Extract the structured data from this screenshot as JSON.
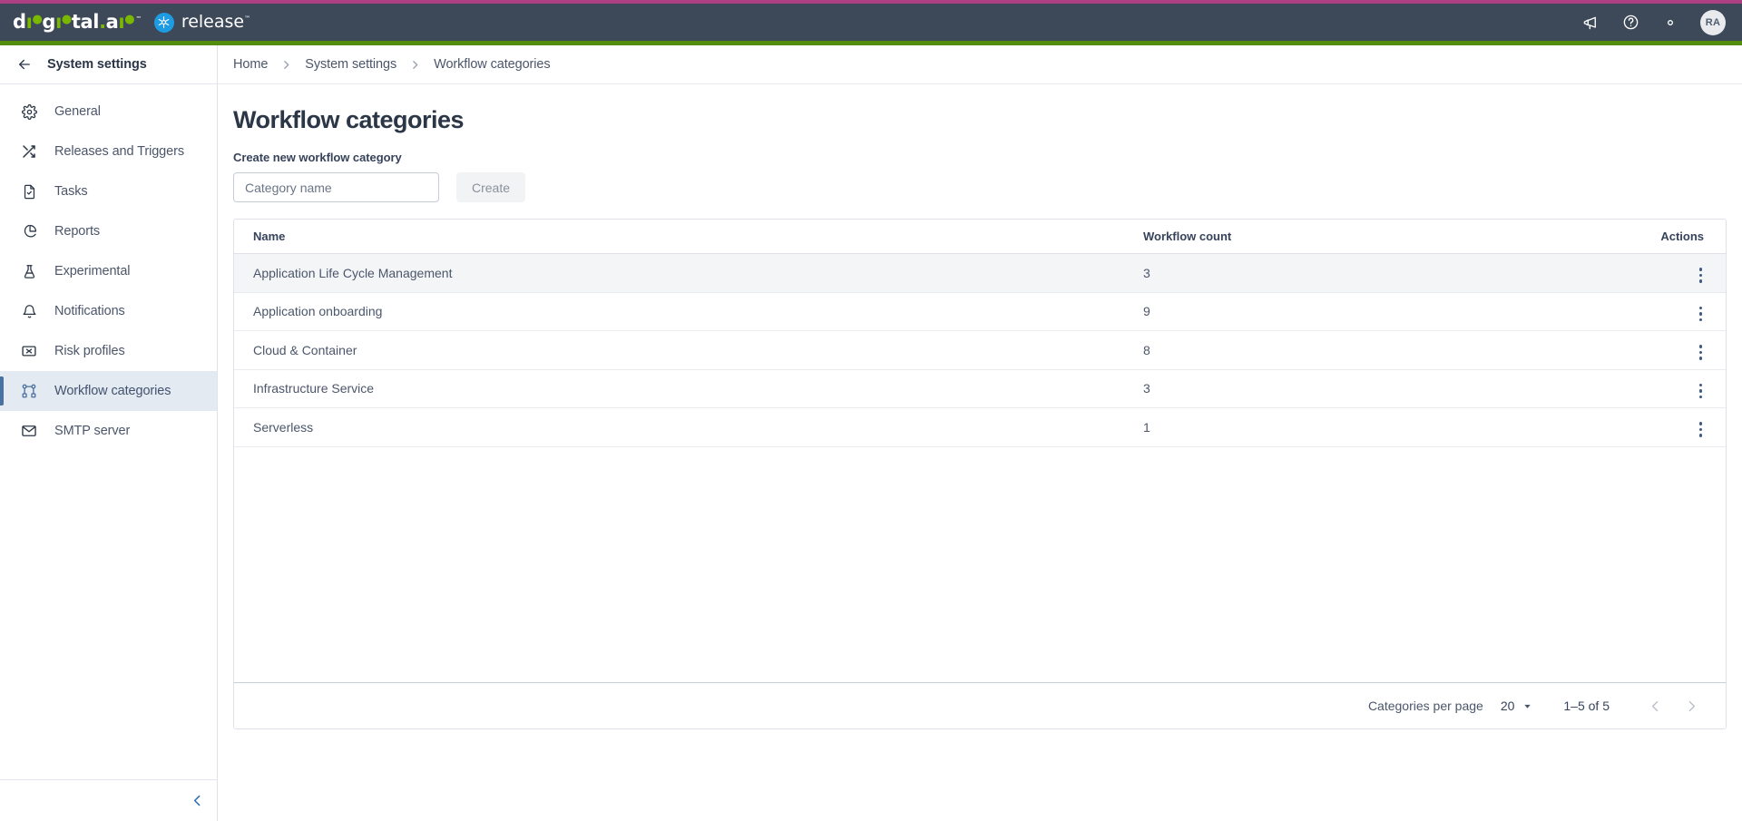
{
  "colors": {
    "top_accent": "#ad3f83",
    "topbar_bg": "#3d4859",
    "green_rule": "#548c0e",
    "brand_blue": "#1e9ce3",
    "logo_green": "#7ab800",
    "sidebar_selected_bg": "#e4eaf2",
    "sidebar_selected_accent": "#4a72a0",
    "row_hover": "#f4f5f7",
    "text_primary": "#2b3647",
    "text_secondary": "#4b566b",
    "border": "#dfe3e9"
  },
  "topbar": {
    "logo_primary": "digital.ai",
    "logo_primary_tm": "™",
    "logo_product": "release",
    "logo_product_tm": "™",
    "product_badge_icon": "release-cycle-icon",
    "actions": [
      {
        "name": "announcements-icon",
        "label": "Announcements"
      },
      {
        "name": "help-icon",
        "label": "Help"
      },
      {
        "name": "gear-icon",
        "label": "Settings"
      }
    ],
    "avatar_initials": "RA"
  },
  "sidebar": {
    "back_icon": "arrow-left-icon",
    "title": "System settings",
    "collapse_icon": "chevron-left-icon",
    "items": [
      {
        "label": "General",
        "icon": "gear-icon",
        "selected": false
      },
      {
        "label": "Releases and Triggers",
        "icon": "shuffle-icon",
        "selected": false
      },
      {
        "label": "Tasks",
        "icon": "document-check-icon",
        "selected": false
      },
      {
        "label": "Reports",
        "icon": "pie-chart-icon",
        "selected": false
      },
      {
        "label": "Experimental",
        "icon": "flask-icon",
        "selected": false
      },
      {
        "label": "Notifications",
        "icon": "bell-icon",
        "selected": false
      },
      {
        "label": "Risk profiles",
        "icon": "risk-shield-icon",
        "selected": false
      },
      {
        "label": "Workflow categories",
        "icon": "workflow-nodes-icon",
        "selected": true
      },
      {
        "label": "SMTP server",
        "icon": "envelope-icon",
        "selected": false
      }
    ]
  },
  "breadcrumb": {
    "separator_icon": "chevron-right-icon",
    "items": [
      {
        "label": "Home"
      },
      {
        "label": "System settings"
      },
      {
        "label": "Workflow categories"
      }
    ]
  },
  "page": {
    "title": "Workflow categories",
    "create_section_label": "Create new workflow category",
    "input_placeholder": "Category name",
    "input_value": "",
    "create_button_label": "Create",
    "create_button_disabled": true
  },
  "table": {
    "columns": {
      "name": "Name",
      "count": "Workflow count",
      "actions": "Actions"
    },
    "row_action_icon": "kebab-menu-icon",
    "rows": [
      {
        "name": "Application Life Cycle Management",
        "count": "3",
        "hovered": true
      },
      {
        "name": "Application onboarding",
        "count": "9",
        "hovered": false
      },
      {
        "name": "Cloud & Container",
        "count": "8",
        "hovered": false
      },
      {
        "name": "Infrastructure Service",
        "count": "3",
        "hovered": false
      },
      {
        "name": "Serverless",
        "count": "1",
        "hovered": false
      }
    ]
  },
  "pagination": {
    "per_page_label": "Categories per page",
    "per_page_value": "20",
    "per_page_caret_icon": "caret-down-icon",
    "range_text": "1–5 of 5",
    "prev_icon": "chevron-left-icon",
    "next_icon": "chevron-right-icon"
  }
}
